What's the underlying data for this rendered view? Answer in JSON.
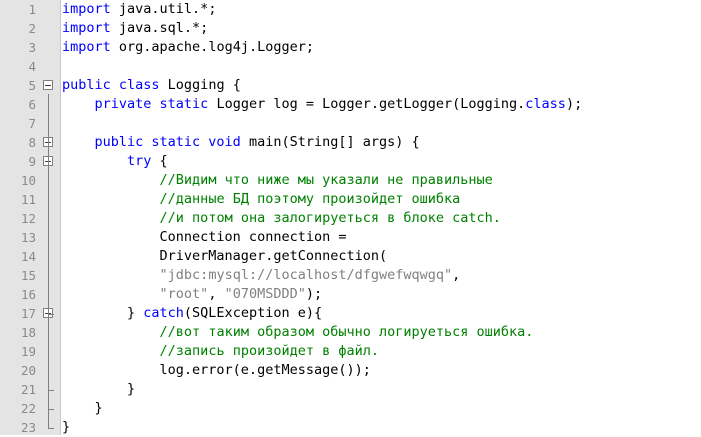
{
  "editor": {
    "lines": [
      {
        "num": "1",
        "tokens": [
          {
            "t": "kw",
            "v": "import"
          },
          {
            "t": "tx",
            "v": " java.util.*;"
          }
        ]
      },
      {
        "num": "2",
        "tokens": [
          {
            "t": "kw",
            "v": "import"
          },
          {
            "t": "tx",
            "v": " java.sql.*;"
          }
        ]
      },
      {
        "num": "3",
        "tokens": [
          {
            "t": "kw",
            "v": "import"
          },
          {
            "t": "tx",
            "v": " org.apache.log4j.Logger;"
          }
        ]
      },
      {
        "num": "4",
        "tokens": []
      },
      {
        "num": "5",
        "tokens": [
          {
            "t": "kw",
            "v": "public class"
          },
          {
            "t": "tx",
            "v": " Logging {"
          }
        ],
        "fold": true
      },
      {
        "num": "6",
        "tokens": [
          {
            "t": "tx",
            "v": "    "
          },
          {
            "t": "kw",
            "v": "private static"
          },
          {
            "t": "tx",
            "v": " Logger log = Logger.getLogger(Logging."
          },
          {
            "t": "kw",
            "v": "class"
          },
          {
            "t": "tx",
            "v": ");"
          }
        ]
      },
      {
        "num": "7",
        "tokens": []
      },
      {
        "num": "8",
        "tokens": [
          {
            "t": "tx",
            "v": "    "
          },
          {
            "t": "kw",
            "v": "public static void"
          },
          {
            "t": "tx",
            "v": " main(String[] args) {"
          }
        ],
        "fold": true
      },
      {
        "num": "9",
        "tokens": [
          {
            "t": "tx",
            "v": "        "
          },
          {
            "t": "kw",
            "v": "try"
          },
          {
            "t": "tx",
            "v": " {"
          }
        ],
        "fold": true
      },
      {
        "num": "10",
        "tokens": [
          {
            "t": "tx",
            "v": "            "
          },
          {
            "t": "cm",
            "v": "//Видим что ниже мы указали не правильные"
          }
        ]
      },
      {
        "num": "11",
        "tokens": [
          {
            "t": "tx",
            "v": "            "
          },
          {
            "t": "cm",
            "v": "//данные БД поэтому произойдет ошибка"
          }
        ]
      },
      {
        "num": "12",
        "tokens": [
          {
            "t": "tx",
            "v": "            "
          },
          {
            "t": "cm",
            "v": "//и потом она залогируеться в блоке catch."
          }
        ]
      },
      {
        "num": "13",
        "tokens": [
          {
            "t": "tx",
            "v": "            Connection connection ="
          }
        ]
      },
      {
        "num": "14",
        "tokens": [
          {
            "t": "tx",
            "v": "            DriverManager.getConnection("
          }
        ]
      },
      {
        "num": "15",
        "tokens": [
          {
            "t": "tx",
            "v": "            "
          },
          {
            "t": "str",
            "v": "\"jdbc:mysql://localhost/dfgwefwqwgq\""
          },
          {
            "t": "tx",
            "v": ","
          }
        ]
      },
      {
        "num": "16",
        "tokens": [
          {
            "t": "tx",
            "v": "            "
          },
          {
            "t": "str",
            "v": "\"root\""
          },
          {
            "t": "tx",
            "v": ", "
          },
          {
            "t": "str",
            "v": "\"070MSDDD\""
          },
          {
            "t": "tx",
            "v": ");"
          }
        ]
      },
      {
        "num": "17",
        "tokens": [
          {
            "t": "tx",
            "v": "        } "
          },
          {
            "t": "kw",
            "v": "catch"
          },
          {
            "t": "tx",
            "v": "(SQLException e){"
          }
        ],
        "fold": true
      },
      {
        "num": "18",
        "tokens": [
          {
            "t": "tx",
            "v": "            "
          },
          {
            "t": "cm",
            "v": "//вот таким образом обычно логируеться ошибка."
          }
        ]
      },
      {
        "num": "19",
        "tokens": [
          {
            "t": "tx",
            "v": "            "
          },
          {
            "t": "cm",
            "v": "//запись произойдет в файл."
          }
        ]
      },
      {
        "num": "20",
        "tokens": [
          {
            "t": "tx",
            "v": "            log.error(e.getMessage());"
          }
        ]
      },
      {
        "num": "21",
        "tokens": [
          {
            "t": "tx",
            "v": "        }"
          }
        ]
      },
      {
        "num": "22",
        "tokens": [
          {
            "t": "tx",
            "v": "    }"
          }
        ]
      },
      {
        "num": "23",
        "tokens": [
          {
            "t": "tx",
            "v": "}"
          }
        ]
      }
    ]
  },
  "colors": {
    "keyword": "#0000ff",
    "comment": "#008000",
    "string": "#808080",
    "text": "#000000",
    "gutter": "#e4e4e4",
    "line_number": "#8a8a8a"
  }
}
